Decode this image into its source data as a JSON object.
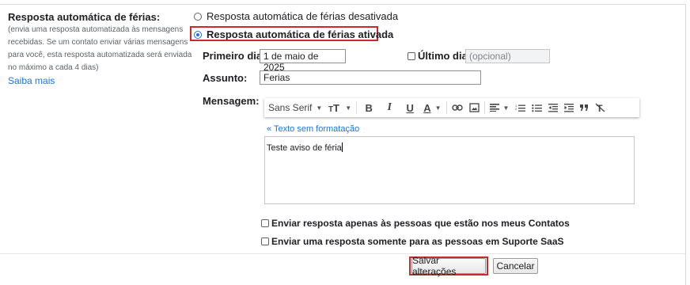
{
  "vacation": {
    "title": "Resposta automática de férias:",
    "description": "(envia uma resposta automatizada às mensagens recebidas. Se um contato enviar várias mensagens para você, esta resposta automatizada será enviada no máximo a cada 4 dias)",
    "learn_more": "Saiba mais",
    "option_off": "Resposta automática de férias desativada",
    "option_on": "Resposta automática de férias ativada",
    "selected": "on"
  },
  "form": {
    "first_day_label": "Primeiro dia:",
    "first_day_value": "1 de maio de 2025",
    "last_day_label": "Último dia:",
    "last_day_placeholder": "(opcional)",
    "subject_label": "Assunto:",
    "subject_value": "Ferias",
    "message_label": "Mensagem:"
  },
  "editor": {
    "font_name": "Sans Serif",
    "plain_text_link": "« Texto sem formatação",
    "body": "Teste aviso de féria",
    "toolbar_icons": [
      "font-size-icon",
      "bold-icon",
      "italic-icon",
      "underline-icon",
      "text-color-icon",
      "link-icon",
      "image-icon",
      "align-icon",
      "numbered-list-icon",
      "bulleted-list-icon",
      "indent-less-icon",
      "indent-more-icon",
      "quote-icon",
      "remove-formatting-icon"
    ]
  },
  "options": {
    "contacts_only": "Enviar resposta apenas às pessoas que estão nos meus Contatos",
    "org_only": "Enviar uma resposta somente para as pessoas em Suporte SaaS"
  },
  "actions": {
    "save": "Salvar alterações",
    "cancel": "Cancelar"
  },
  "colors": {
    "highlight": "#cc2a2a",
    "link": "#1a73e8"
  }
}
